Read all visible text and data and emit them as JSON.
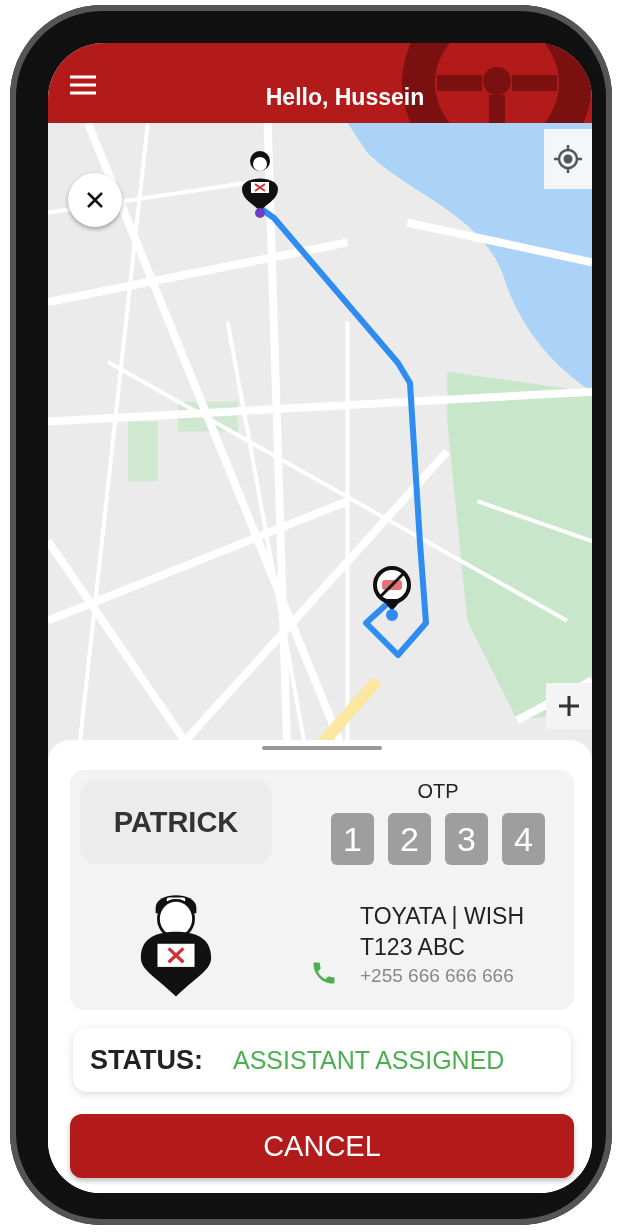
{
  "header": {
    "title": "Hello, Hussein"
  },
  "assistant": {
    "name": "PATRICK",
    "vehicle": "TOYATA | WISH",
    "plate": "T123 ABC",
    "phone": "+255 666 666 666"
  },
  "otp": {
    "label": "OTP",
    "digits": [
      "1",
      "2",
      "3",
      "4"
    ]
  },
  "status": {
    "label": "STATUS:",
    "value": "ASSISTANT ASSIGNED"
  },
  "cancel_button": {
    "label": "CANCEL"
  }
}
